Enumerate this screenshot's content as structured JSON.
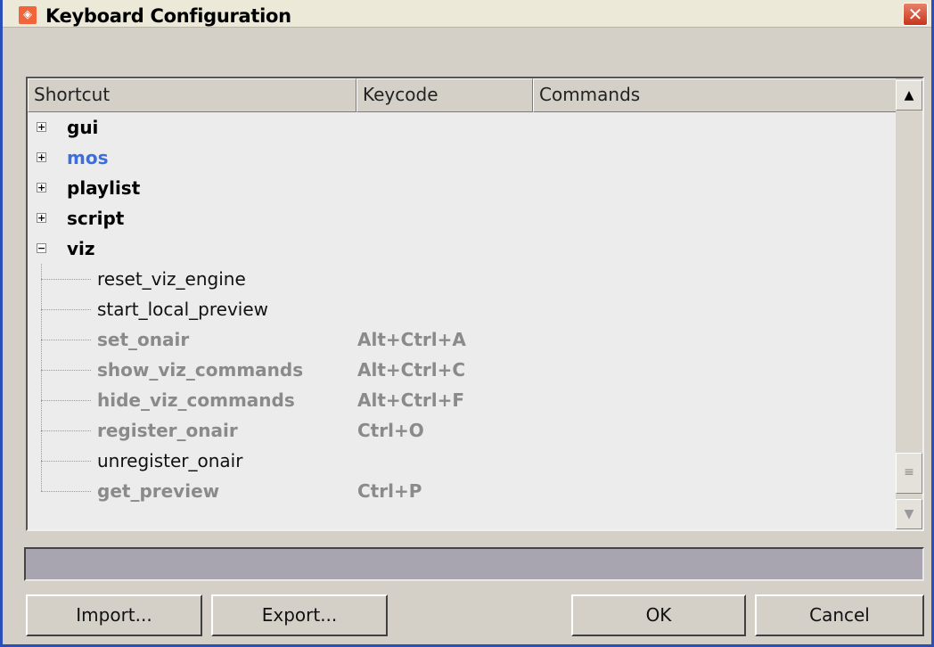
{
  "window": {
    "title": "Keyboard Configuration",
    "close_glyph": "✕",
    "app_icon_glyph": "◈"
  },
  "table": {
    "columns": [
      "Shortcut",
      "Keycode",
      "Commands"
    ],
    "groups": [
      {
        "label": "gui",
        "expander": "+"
      },
      {
        "label": "mos",
        "expander": "+"
      },
      {
        "label": "playlist",
        "expander": "+"
      },
      {
        "label": "script",
        "expander": "+"
      },
      {
        "label": "viz",
        "expander": "−"
      }
    ],
    "viz_items": [
      {
        "label": "reset_viz_engine",
        "keycode": ""
      },
      {
        "label": "start_local_preview",
        "keycode": ""
      },
      {
        "label": "set_onair",
        "keycode": "Alt+Ctrl+A"
      },
      {
        "label": "show_viz_commands",
        "keycode": "Alt+Ctrl+C"
      },
      {
        "label": "hide_viz_commands",
        "keycode": "Alt+Ctrl+F"
      },
      {
        "label": "register_onair",
        "keycode": "Ctrl+O"
      },
      {
        "label": "unregister_onair",
        "keycode": ""
      },
      {
        "label": "get_preview",
        "keycode": "Ctrl+P"
      }
    ]
  },
  "scrollbar": {
    "up_glyph": "▲",
    "down_glyph": "▼",
    "thumb_glyph": "≡"
  },
  "buttons": {
    "import_label": "Import...",
    "export_label": "Export...",
    "ok_label": "OK",
    "cancel_label": "Cancel"
  },
  "colors": {
    "highlight_group": "#3b6ee0",
    "dim_text": "#8a8a8a"
  }
}
